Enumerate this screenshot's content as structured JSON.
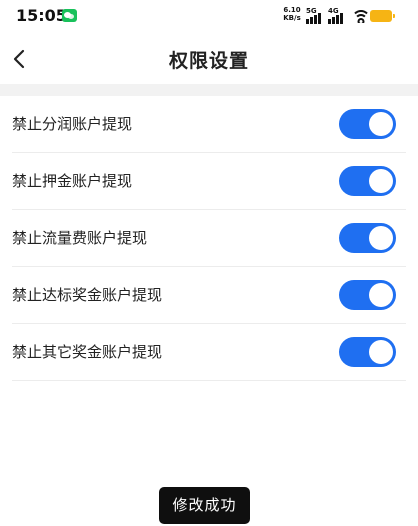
{
  "status_bar": {
    "time": "15:05",
    "net_speed_value": "6.10",
    "net_speed_unit": "KB/s",
    "network_labels": [
      "5G",
      "4G"
    ],
    "icons": [
      "wechat-icon",
      "signal-icon",
      "wifi-icon",
      "battery-icon"
    ],
    "battery_color": "#f6b414"
  },
  "nav": {
    "title": "权限设置",
    "back_icon": "chevron-left-icon"
  },
  "settings": [
    {
      "label": "禁止分润账户提现",
      "enabled": true
    },
    {
      "label": "禁止押金账户提现",
      "enabled": true
    },
    {
      "label": "禁止流量费账户提现",
      "enabled": true
    },
    {
      "label": "禁止达标奖金账户提现",
      "enabled": true
    },
    {
      "label": "禁止其它奖金账户提现",
      "enabled": true
    }
  ],
  "toast": {
    "message": "修改成功"
  },
  "colors": {
    "toggle_on": "#1f6ff1",
    "divider": "#ececec",
    "section_gap": "#f2f2f2"
  }
}
